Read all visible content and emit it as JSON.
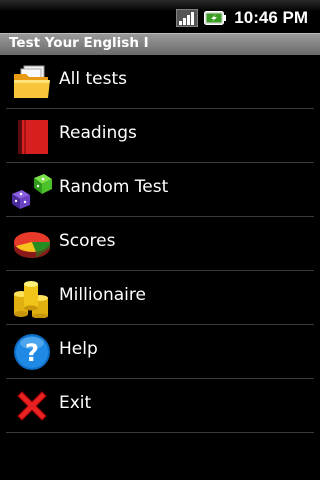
{
  "status_bar": {
    "time": "10:46 PM",
    "signal_icon": "signal-icon",
    "battery_icon": "battery-charging-icon"
  },
  "app": {
    "title": "Test Your English I"
  },
  "menu": {
    "items": [
      {
        "label": "All tests",
        "icon": "folder-icon"
      },
      {
        "label": "Readings",
        "icon": "book-icon"
      },
      {
        "label": "Random Test",
        "icon": "dice-icon"
      },
      {
        "label": "Scores",
        "icon": "pie-chart-icon"
      },
      {
        "label": "Millionaire",
        "icon": "coins-icon"
      },
      {
        "label": "Help",
        "icon": "help-icon"
      },
      {
        "label": "Exit",
        "icon": "close-icon"
      }
    ]
  }
}
